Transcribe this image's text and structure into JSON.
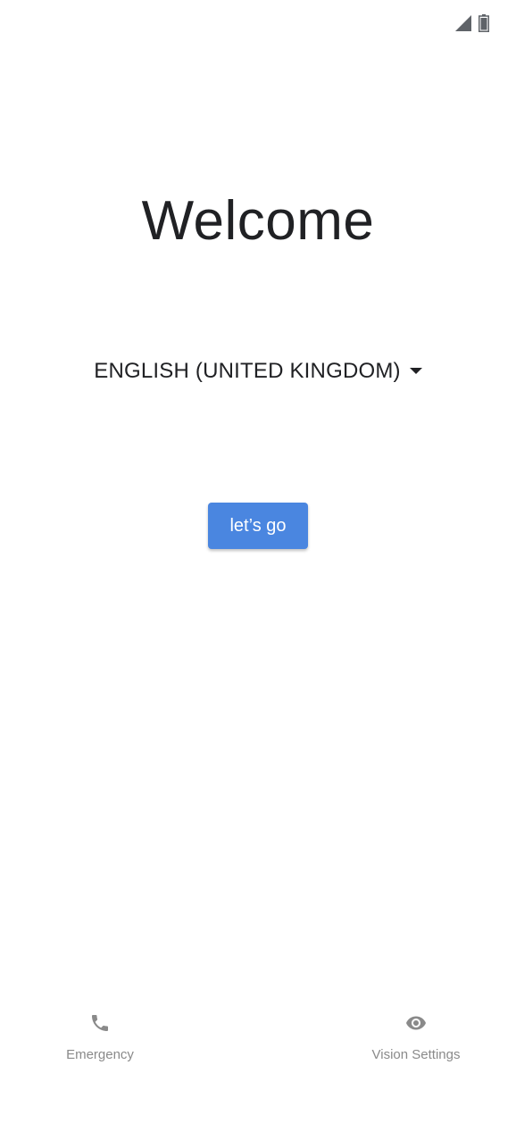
{
  "status_bar": {
    "signal_icon": "cell-signal-icon",
    "battery_icon": "battery-icon"
  },
  "welcome": {
    "title": "Welcome"
  },
  "language": {
    "selected": "ENGLISH (UNITED KINGDOM)",
    "dropdown_icon": "caret-down-icon"
  },
  "start_button": {
    "label": "let’s go",
    "color": "#4a86e0"
  },
  "bottom_actions": {
    "emergency": {
      "label": "Emergency",
      "icon": "phone-icon"
    },
    "vision_settings": {
      "label": "Vision Settings",
      "icon": "eye-icon"
    }
  }
}
